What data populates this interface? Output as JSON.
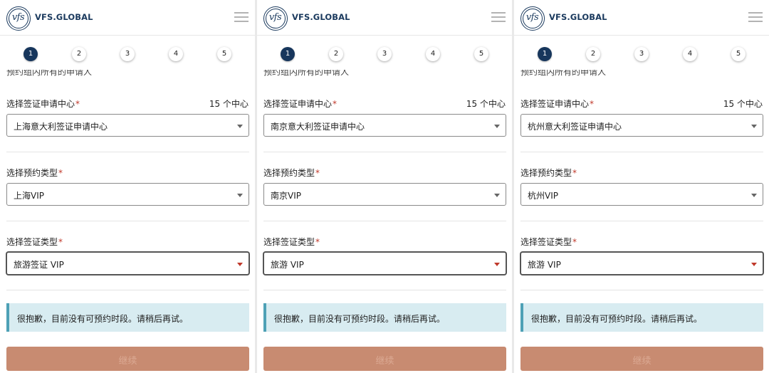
{
  "brand": {
    "name": "VFS.GLOBAL",
    "mark": "vfs"
  },
  "steps": [
    "1",
    "2",
    "3",
    "4",
    "5"
  ],
  "active_step": "1",
  "cut_text": "预约组内所有的申请人",
  "labels": {
    "center": "选择签证申请中心",
    "appointment_type": "选择预约类型",
    "visa_type": "选择签证类型",
    "required_mark": "*",
    "center_count": "15 个中心"
  },
  "panels": [
    {
      "center_value": "上海意大利签证申请中心",
      "appointment_value": "上海VIP",
      "visa_value": "旅游签证 VIP"
    },
    {
      "center_value": "南京意大利签证申请中心",
      "appointment_value": "南京VIP",
      "visa_value": "旅游 VIP"
    },
    {
      "center_value": "杭州意大利签证申请中心",
      "appointment_value": "杭州VIP",
      "visa_value": "旅游 VIP"
    }
  ],
  "alert_text": "很抱歉，目前没有可预约时段。请稍后再试。",
  "continue_label": "继续",
  "icons": {
    "menu": "hamburger-menu-icon",
    "dropdown": "chevron-down-icon"
  },
  "colors": {
    "brand_navy": "#17365c",
    "alert_bg": "#d8ecf1",
    "alert_border": "#4ea1b6",
    "button_disabled": "#c88b71",
    "required": "#c0392b"
  }
}
